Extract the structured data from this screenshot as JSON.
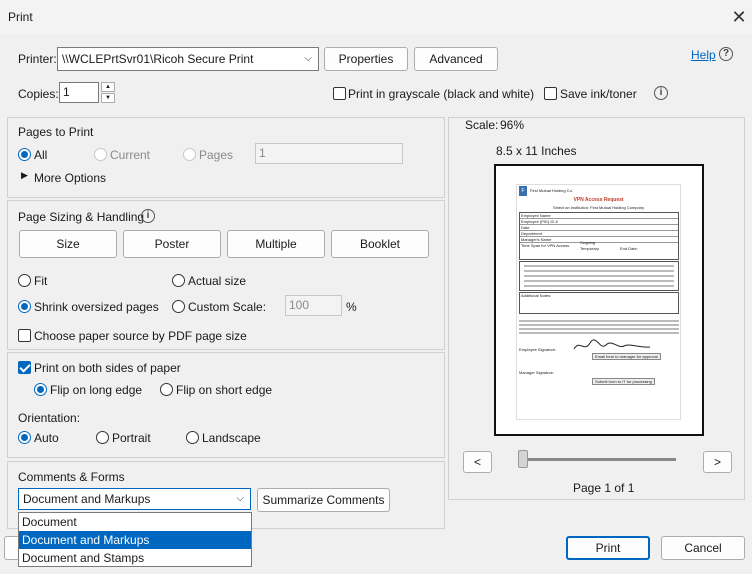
{
  "window": {
    "title": "Print",
    "close_glyph": "✕"
  },
  "printer": {
    "label": "Printer:",
    "selected": "\\\\WCLEPrtSvr01\\Ricoh Secure Print",
    "properties_btn": "Properties",
    "advanced_btn": "Advanced",
    "help_link": "Help",
    "help_glyph": "?"
  },
  "copies": {
    "label": "Copies:",
    "value": "1",
    "grayscale_label": "Print in grayscale (black and white)",
    "grayscale_checked": false,
    "save_ink_label": "Save ink/toner",
    "save_ink_checked": false,
    "info_glyph": "i"
  },
  "pages_to_print": {
    "heading": "Pages to Print",
    "options": [
      "All",
      "Current",
      "Pages"
    ],
    "selected": "All",
    "pages_value": "1",
    "more_options": "More Options"
  },
  "sizing": {
    "heading": "Page Sizing & Handling",
    "info_glyph": "i",
    "tabs": [
      "Size",
      "Poster",
      "Multiple",
      "Booklet"
    ],
    "fit_label": "Fit",
    "actual_size_label": "Actual size",
    "shrink_label": "Shrink oversized pages",
    "custom_scale_label": "Custom Scale:",
    "custom_scale_value": "100",
    "percent": "%",
    "selected": "Shrink oversized pages",
    "paper_source_label": "Choose paper source by PDF page size",
    "paper_source_checked": false
  },
  "duplex": {
    "both_sides_label": "Print on both sides of paper",
    "both_sides_checked": true,
    "flip_long": "Flip on long edge",
    "flip_short": "Flip on short edge",
    "selected_flip": "Flip on long edge",
    "orientation_label": "Orientation:",
    "orientations": [
      "Auto",
      "Portrait",
      "Landscape"
    ],
    "selected_orientation": "Auto"
  },
  "comments": {
    "heading": "Comments & Forms",
    "selected": "Document and Markups",
    "summarize_btn": "Summarize Comments",
    "options": [
      "Document",
      "Document and Markups",
      "Document and Stamps"
    ]
  },
  "preview": {
    "scale_label": "Scale:",
    "scale_value": "96%",
    "paper_size": "8.5 x 11 Inches",
    "prev_glyph": "<",
    "next_glyph": ">",
    "page_indicator": "Page 1 of 1",
    "slider_fraction": 0,
    "doc": {
      "org": "First Mutual Holding Co.",
      "title": "VPN Access Request",
      "subtitle": "Select an Institution: First Mutual Holding Company",
      "fields": [
        "Employee Name",
        "Employee (PID) ID #",
        "Date",
        "Department",
        "Manager's Name"
      ],
      "time_span_label": "Time Span for VPN Access",
      "ongoing": "Ongoing",
      "temporary": "Temporary",
      "end_date": "End Date:",
      "additional_notes": "Additional Notes:",
      "employee_sig": "Employee Signature:",
      "manager_sig": "Manager Signature:",
      "submit_manager": "Email form to manager for approval",
      "submit_it": "Submit form to IT for processing"
    }
  },
  "footer": {
    "print_btn": "Print",
    "cancel_btn": "Cancel"
  },
  "colors": {
    "accent": "#0067c0",
    "link": "#0067c0",
    "doc_title_red": "#c0392b"
  }
}
